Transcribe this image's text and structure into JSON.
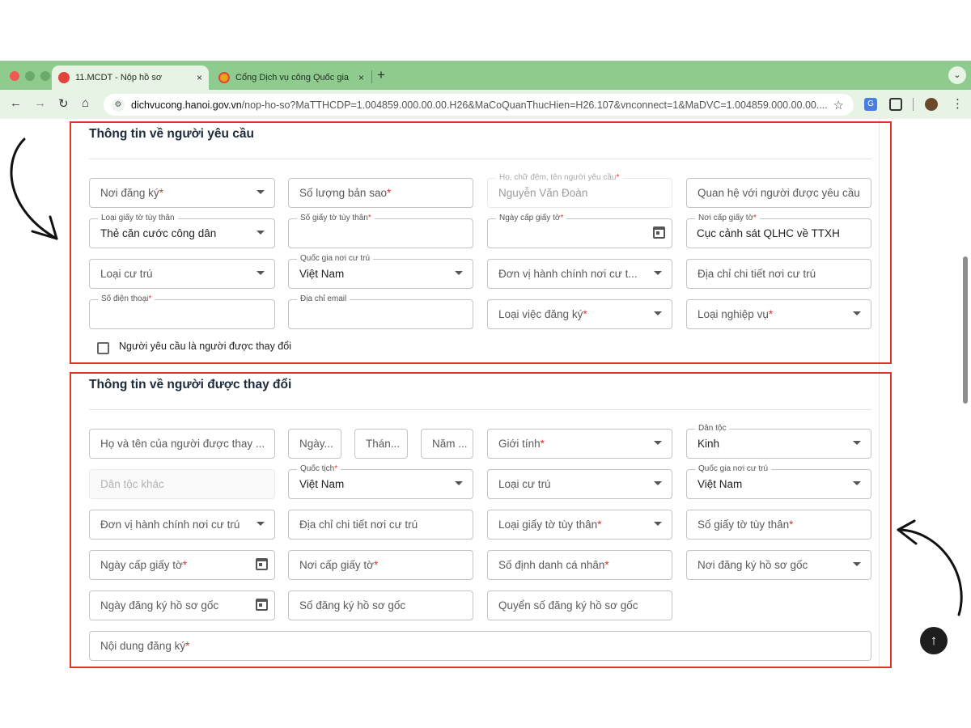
{
  "browser": {
    "tabs": [
      {
        "title": "11.MCDT - Nộp hồ sơ",
        "close": "×"
      },
      {
        "title": "Cổng Dịch vụ công Quốc gia",
        "close": "×"
      }
    ],
    "new_tab": "+",
    "url_host": "dichvucong.hanoi.gov.vn",
    "url_path": "/nop-ho-so?MaTTHCDP=1.004859.000.00.00.H26&MaCoQuanThucHien=H26.107&vnconnect=1&MaDVC=1.004859.000.00.00...."
  },
  "section1": {
    "title": "Thông tin về người yêu cầu",
    "fields": {
      "noi_dang_ky": {
        "placeholder": "Nơi đăng ký",
        "req": "*"
      },
      "so_luong_ban_sao": {
        "placeholder": "Số lượng bản sao",
        "req": "*"
      },
      "ho_ten": {
        "label": "Họ, chữ đệm, tên người yêu cầu",
        "req": "*",
        "value": "Nguyễn Văn Đoàn"
      },
      "quan_he": {
        "placeholder": "Quan hệ với người được yêu cầu"
      },
      "loai_giay_to": {
        "label": "Loại giấy tờ tùy thân",
        "value": "Thẻ căn cước công dân"
      },
      "so_giay_to": {
        "label": "Số giấy tờ tùy thân",
        "req": "*"
      },
      "ngay_cap": {
        "label": "Ngày cấp giấy tờ",
        "req": "*"
      },
      "noi_cap": {
        "label": "Nơi cấp giấy tờ",
        "req": "*",
        "value": "Cục cảnh sát QLHC về TTXH"
      },
      "loai_cu_tru": {
        "placeholder": "Loại cư trú"
      },
      "quoc_gia": {
        "label": "Quốc gia nơi cư trú",
        "value": "Việt Nam"
      },
      "don_vi_hc": {
        "placeholder": "Đơn vị hành chính nơi cư t..."
      },
      "dia_chi": {
        "placeholder": "Địa chỉ chi tiết nơi cư trú"
      },
      "so_dien_thoai": {
        "label": "Số điện thoại",
        "req": "*"
      },
      "email": {
        "label": "Địa chỉ email"
      },
      "loai_viec": {
        "placeholder": "Loại việc đăng ký",
        "req": "*"
      },
      "loai_nghiep_vu": {
        "placeholder": "Loại nghiệp vụ",
        "req": "*"
      }
    },
    "checkbox_label": "Người yêu cầu là người được thay đổi"
  },
  "section2": {
    "title": "Thông tin về người được thay đổi",
    "fields": {
      "ho_ten": {
        "placeholder": "Họ và tên của người được thay ..."
      },
      "ngay": {
        "placeholder": "Ngày..."
      },
      "thang": {
        "placeholder": "Thán..."
      },
      "nam": {
        "placeholder": "Năm ..."
      },
      "gioi_tinh": {
        "placeholder": "Giới tính",
        "req": "*"
      },
      "dan_toc": {
        "label": "Dân tộc",
        "value": "Kinh"
      },
      "dan_toc_khac": {
        "placeholder": "Dân tộc khác"
      },
      "quoc_tich": {
        "label": "Quốc tịch",
        "req": "*",
        "value": "Việt Nam"
      },
      "loai_cu_tru": {
        "placeholder": "Loại cư trú"
      },
      "quoc_gia": {
        "label": "Quốc gia nơi cư trú",
        "value": "Việt Nam"
      },
      "don_vi_hc": {
        "placeholder": "Đơn vị hành chính nơi cư trú"
      },
      "dia_chi": {
        "placeholder": "Địa chỉ chi tiết nơi cư trú"
      },
      "loai_giay_to": {
        "placeholder": "Loại giấy tờ tùy thân",
        "req": "*"
      },
      "so_giay_to": {
        "placeholder": "Số giấy tờ tùy thân",
        "req": "*"
      },
      "ngay_cap": {
        "placeholder": "Ngày cấp giấy tờ",
        "req": "*"
      },
      "noi_cap": {
        "placeholder": "Nơi cấp giấy tờ",
        "req": "*"
      },
      "so_dinh_danh": {
        "placeholder": "Số định danh cá nhân",
        "req": "*"
      },
      "noi_dang_ky_goc": {
        "placeholder": "Nơi đăng ký hồ sơ gốc"
      },
      "ngay_dang_ky_goc": {
        "placeholder": "Ngày đăng ký hồ sơ gốc"
      },
      "so_dang_ky_goc": {
        "placeholder": "Số đăng ký hồ sơ gốc"
      },
      "quyen_so_goc": {
        "placeholder": "Quyển số đăng ký hồ sơ gốc"
      },
      "noi_dung": {
        "placeholder": "Nội dung đăng ký",
        "req": "*"
      }
    }
  },
  "colors": {
    "highlight": "#e2342c",
    "chrome": "#8fcb8e",
    "toolbar": "#e6f3e5"
  },
  "icons": [
    "reload-icon",
    "home-icon",
    "star-icon",
    "calendar-icon",
    "arrow-up-icon",
    "dropdown-caret-icon"
  ]
}
